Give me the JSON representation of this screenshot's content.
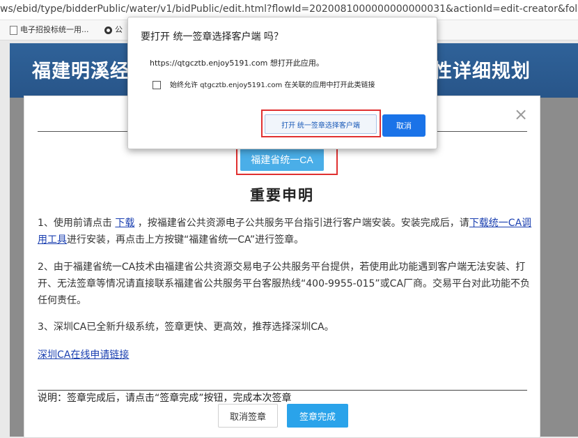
{
  "browser": {
    "url": "ws/ebid/type/bidderPublic/water/v1/bidPublic/edit.html?flowId=2020081000000000000031&actionId=edit-creator&folc",
    "bookmarks": [
      {
        "label": "电子招投标统一用...",
        "icon": "page-icon"
      },
      {
        "label": "公",
        "icon": "globe-icon"
      }
    ]
  },
  "site": {
    "title_left": "福建明溪经",
    "title_right": "性详细规划"
  },
  "modal": {
    "close_symbol": "×",
    "ca_button_label": "福建省统一CA",
    "notice_title": "重要申明",
    "para1": {
      "part1": "1、使用前请点击 ",
      "link_download": "下载",
      "part2": " ，按福建省公共资源电子公共服务平台指引进行客户端安装。安装完成后，请",
      "link_tool": "下载统一CA调用工具",
      "part3": "进行安装，再点击上方按键“福建省统一CA”进行签章。"
    },
    "para2": "2、由于福建省统一CA技术由福建省公共资源交易电子公共服务平台提供，若使用此功能遇到客户端无法安装、打开、无法签章等情况请直接联系福建省公共服务平台客服热线“400-9955-015”或CA厂商。交易平台对此功能不负任何责任。",
    "para3": "3、深圳CA已全新升级系统，签章更快、更高效，推荐选择深圳CA。",
    "link_shenzhen": "深圳CA在线申请链接",
    "footer_note": "说明：签章完成后，请点击“签章完成”按钮，完成本次签章",
    "cancel_sign_label": "取消签章",
    "finish_sign_label": "签章完成"
  },
  "dialog": {
    "title": "要打开 统一签章选择客户端 吗？",
    "message": "https://qtgcztb.enjoy5191.com 想打开此应用。",
    "checkbox_label": "始终允许 qtgcztb.enjoy5191.com 在关联的应用中打开此类链接",
    "checkbox_checked": false,
    "open_button_label": "打开 统一签章选择客户端",
    "cancel_button_label": "取消"
  },
  "colors": {
    "header_blue": "#2a5a8e",
    "ca_button": "#4aaee8",
    "finish_button": "#2aa3ea",
    "dialog_cancel": "#1a73e8",
    "highlight_frame": "#e03030",
    "link": "#1a3fb0"
  }
}
